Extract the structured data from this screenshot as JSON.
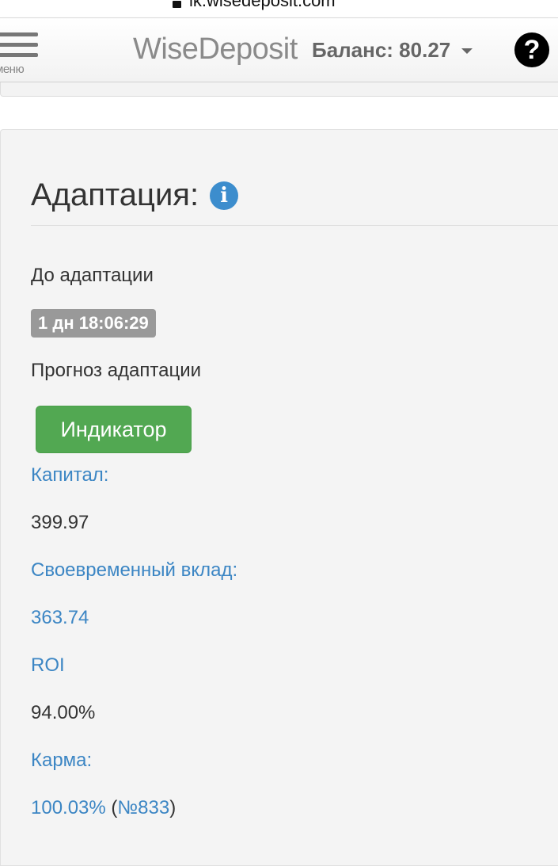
{
  "browser": {
    "url": "lk.wisedeposit.com"
  },
  "navbar": {
    "menu_label": "меню",
    "brand": "WiseDeposit",
    "balance": "Баланс: 80.27",
    "help_symbol": "?"
  },
  "panel": {
    "title": "Адаптация:",
    "info_symbol": "i",
    "until_label": "До адаптации",
    "countdown": "1 дн 18:06:29",
    "forecast_label": "Прогноз адаптации",
    "indicator_button": "Индикатор",
    "capital_label": "Капитал:",
    "capital_value": "399.97",
    "timely_deposit_label": "Своевременный вклад:",
    "timely_deposit_value": "363.74",
    "roi_label": "ROI",
    "roi_value": "94.00%",
    "karma_label": "Карма:",
    "karma_value": "100.03%",
    "karma_rank_open": "(",
    "karma_rank": "№833",
    "karma_rank_close": ")"
  },
  "colors": {
    "link": "#3c86c4",
    "button_green": "#52a852",
    "badge_gray": "#999999",
    "info_blue": "#3c8dcd"
  }
}
